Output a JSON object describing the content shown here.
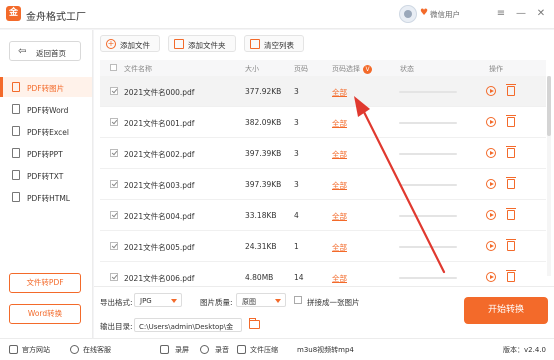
{
  "app": {
    "title": "金舟格式工厂",
    "logo_char": "金"
  },
  "user": {
    "name": "微信用户"
  },
  "window": {
    "menu_icon": "≡",
    "minimize_icon": "—",
    "close_icon": "✕"
  },
  "sidebar": {
    "back_label": "返回首页",
    "items": [
      {
        "label": "PDF转图片",
        "active": true
      },
      {
        "label": "PDF转Word",
        "active": false
      },
      {
        "label": "PDF转Excel",
        "active": false
      },
      {
        "label": "PDF转PPT",
        "active": false
      },
      {
        "label": "PDF转TXT",
        "active": false
      },
      {
        "label": "PDF转HTML",
        "active": false
      }
    ],
    "bottom_buttons": [
      "文件转PDF",
      "Word转换"
    ]
  },
  "toolbar": {
    "add_file": "添加文件",
    "add_folder": "添加文件夹",
    "clear_list": "清空列表"
  },
  "table": {
    "headers": {
      "name": "文件名称",
      "size": "大小",
      "pages": "页码",
      "page_select": "页码选择",
      "status": "状态",
      "actions": "操作"
    },
    "page_select_badge": "V",
    "rows": [
      {
        "name": "2021文件名000.pdf",
        "size": "377.92KB",
        "pages": "3",
        "select": "全部",
        "progress": 0
      },
      {
        "name": "2021文件名001.pdf",
        "size": "382.09KB",
        "pages": "3",
        "select": "全部",
        "progress": 0
      },
      {
        "name": "2021文件名002.pdf",
        "size": "397.39KB",
        "pages": "3",
        "select": "全部",
        "progress": 0
      },
      {
        "name": "2021文件名003.pdf",
        "size": "397.39KB",
        "pages": "3",
        "select": "全部",
        "progress": 0
      },
      {
        "name": "2021文件名004.pdf",
        "size": "33.18KB",
        "pages": "4",
        "select": "全部",
        "progress": 0
      },
      {
        "name": "2021文件名005.pdf",
        "size": "24.31KB",
        "pages": "1",
        "select": "全部",
        "progress": 0
      },
      {
        "name": "2021文件名006.pdf",
        "size": "4.80MB",
        "pages": "14",
        "select": "全部",
        "progress": 0
      }
    ]
  },
  "settings": {
    "format_label": "导出格式:",
    "format_value": "JPG",
    "quality_label": "图片质量:",
    "quality_value": "原图",
    "merge_label": "拼接成一张图片",
    "output_label": "输出目录:",
    "output_value": "C:\\Users\\admin\\Desktop\\金",
    "more": "•••",
    "start_button": "开始转换"
  },
  "footer": {
    "items": [
      "官方网站",
      "在线客服",
      "录屏",
      "录音",
      "文件压缩",
      "m3u8视频转mp4"
    ],
    "version": "版本：v2.4.0"
  },
  "colors": {
    "accent": "#f36a2a",
    "arrow": "#e0392f"
  }
}
